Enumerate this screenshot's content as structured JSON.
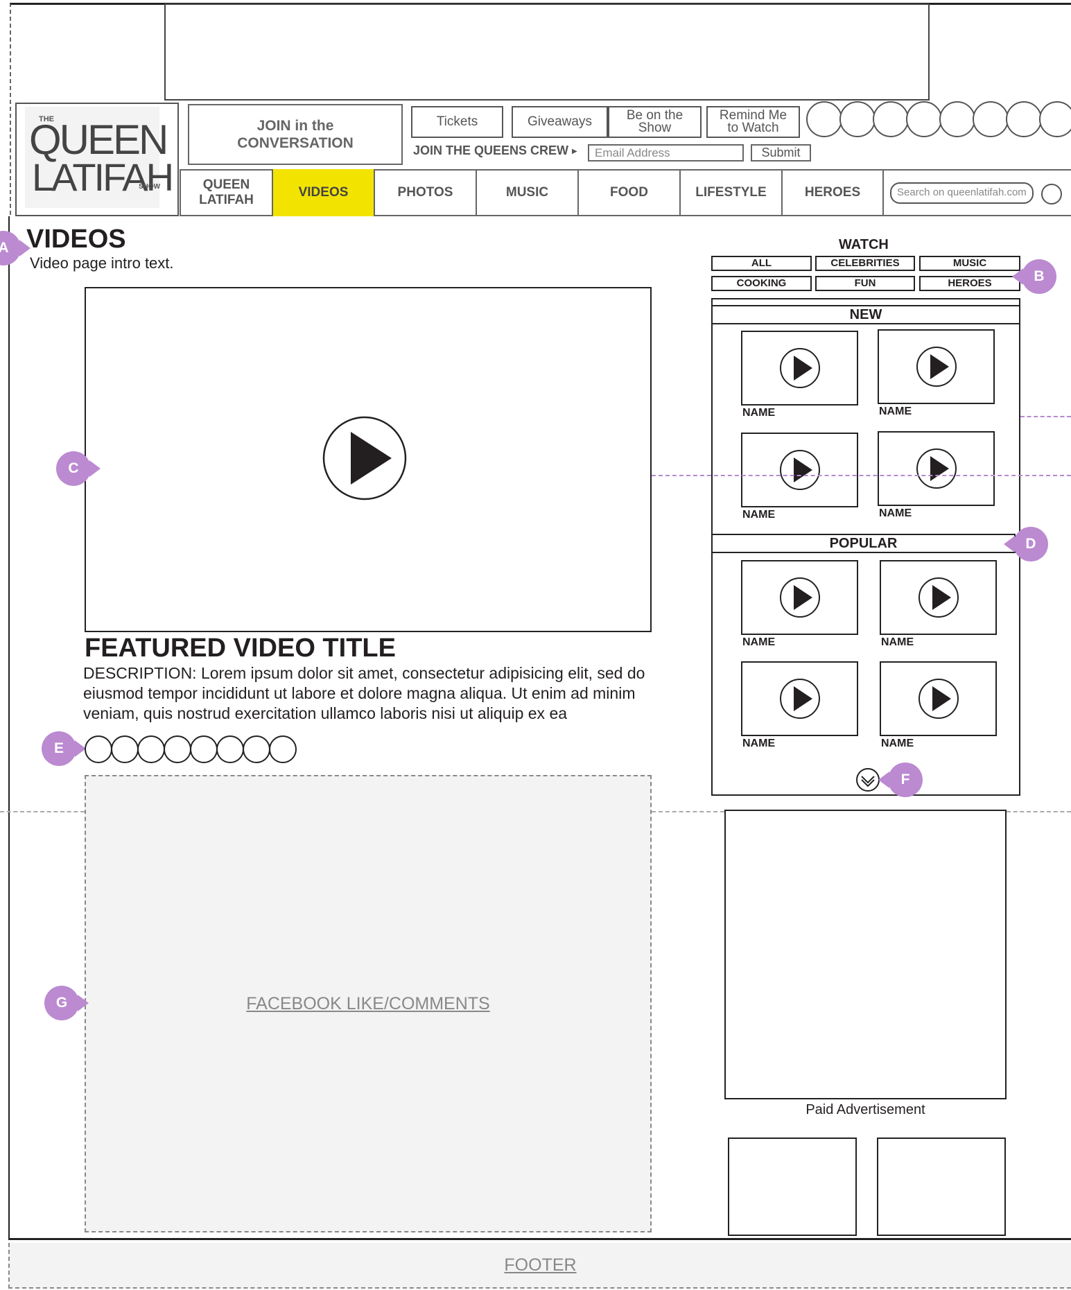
{
  "header": {
    "logo": {
      "the": "THE",
      "line1": "QUEEN",
      "line2": "LATIFAH",
      "show": "SHOW"
    },
    "join": "JOIN in the\nCONVERSATION",
    "top_buttons": [
      "Tickets",
      "Giveaways",
      "Be on the\nShow",
      "Remind Me\nto Watch"
    ],
    "crew_label": "JOIN THE QUEENS CREW",
    "email_placeholder": "Email Address",
    "submit": "Submit",
    "search_placeholder": "Search on queenlatifah.com",
    "nav": [
      {
        "label": "QUEEN\nLATIFAH",
        "active": false
      },
      {
        "label": "VIDEOS",
        "active": true
      },
      {
        "label": "PHOTOS",
        "active": false
      },
      {
        "label": "MUSIC",
        "active": false
      },
      {
        "label": "FOOD",
        "active": false
      },
      {
        "label": "LIFESTYLE",
        "active": false
      },
      {
        "label": "HEROES",
        "active": false
      }
    ],
    "nav_active_color": "#f2e400"
  },
  "markers": {
    "a": "A",
    "b": "B",
    "c": "C",
    "d": "D",
    "e": "E",
    "f": "F",
    "g": "G",
    "color": "#bb8ad0"
  },
  "main": {
    "title": "VIDEOS",
    "intro": "Video page intro text.",
    "featured_title": "FEATURED VIDEO TITLE",
    "description": "DESCRIPTION: Lorem ipsum dolor sit amet, consectetur adipisicing elit, sed do eiusmod tempor incididunt ut labore et dolore magna aliqua. Ut enim ad minim veniam, quis nostrud exercitation ullamco laboris nisi ut aliquip ex ea",
    "facebook": "FACEBOOK LIKE/COMMENTS"
  },
  "sidebar": {
    "watch": "WATCH",
    "filters": [
      "ALL",
      "CELEBRITIES",
      "MUSIC",
      "COOKING",
      "FUN",
      "HEROES"
    ],
    "new_label": "NEW",
    "popular_label": "POPULAR",
    "new_videos": [
      {
        "name": "NAME"
      },
      {
        "name": "NAME"
      },
      {
        "name": "NAME"
      },
      {
        "name": "NAME"
      }
    ],
    "popular_videos": [
      {
        "name": "NAME"
      },
      {
        "name": "NAME"
      },
      {
        "name": "NAME"
      },
      {
        "name": "NAME"
      }
    ],
    "ad_label": "Paid Advertisement"
  },
  "footer": {
    "label": "FOOTER"
  }
}
